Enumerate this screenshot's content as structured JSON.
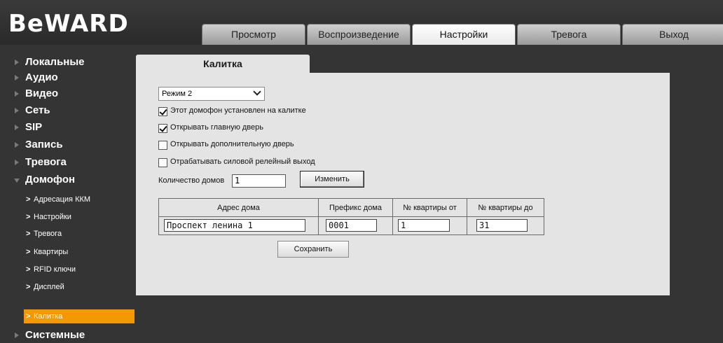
{
  "brand": {
    "logo": "BeWARD"
  },
  "tabs": [
    {
      "label": "Просмотр"
    },
    {
      "label": "Воспроизведение"
    },
    {
      "label": "Настройки"
    },
    {
      "label": "Тревога"
    },
    {
      "label": "Выход"
    }
  ],
  "active_tab": "Настройки",
  "sidebar": {
    "items": [
      {
        "label": "Локальные"
      },
      {
        "label": "Аудио"
      },
      {
        "label": "Видео"
      },
      {
        "label": "Сеть"
      },
      {
        "label": "SIP"
      },
      {
        "label": "Запись"
      },
      {
        "label": "Тревога"
      },
      {
        "label": "Домофон"
      },
      {
        "label": "Системные"
      }
    ],
    "subitems": [
      {
        "label": "Адресация ККМ"
      },
      {
        "label": "Настройки"
      },
      {
        "label": "Тревога"
      },
      {
        "label": "Квартиры"
      },
      {
        "label": "RFID ключи"
      },
      {
        "label": "Дисплей"
      },
      {
        "label": "Калитка"
      }
    ],
    "active_subitem": "Калитка"
  },
  "panel": {
    "title": "Калитка",
    "mode_select": {
      "value": "Режим 2"
    },
    "checkboxes": [
      {
        "label": "Этот домофон установлен на калитке",
        "checked": true
      },
      {
        "label": "Открывать главную дверь",
        "checked": true
      },
      {
        "label": "Открывать дополнительную дверь",
        "checked": false
      },
      {
        "label": "Отрабатывать силовой релейный выход",
        "checked": false
      }
    ],
    "houses_count": {
      "label": "Количество домов",
      "value": "1",
      "button": "Изменить"
    },
    "table": {
      "columns": [
        "Адрес дома",
        "Префикс дома",
        "№ квартиры от",
        "№ квартиры до"
      ],
      "rows": [
        {
          "address": "Проспект ленина 1",
          "prefix": "0001",
          "from": "1",
          "to": "31"
        }
      ]
    },
    "save_button": "Сохранить"
  },
  "colors": {
    "accent": "#f39800",
    "background": "#343434",
    "panel": "#e4e4e4"
  }
}
